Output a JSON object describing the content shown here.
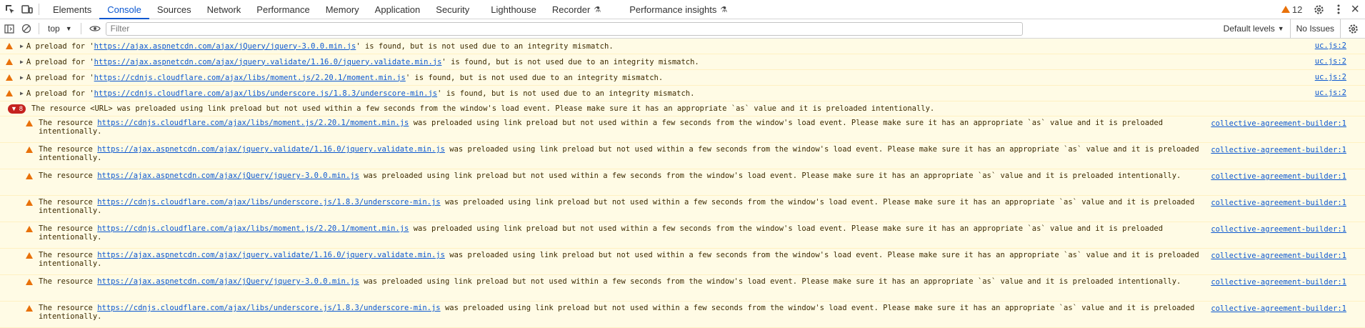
{
  "tabs": [
    {
      "label": "Elements",
      "flask": ""
    },
    {
      "label": "Console",
      "flask": ""
    },
    {
      "label": "Sources",
      "flask": ""
    },
    {
      "label": "Network",
      "flask": ""
    },
    {
      "label": "Performance",
      "flask": ""
    },
    {
      "label": "Memory",
      "flask": ""
    },
    {
      "label": "Application",
      "flask": ""
    },
    {
      "label": "Security",
      "flask": ""
    },
    {
      "label": "Lighthouse",
      "flask": ""
    },
    {
      "label": "Recorder",
      "flask": "⚗"
    },
    {
      "label": "Performance insights",
      "flask": "⚗"
    }
  ],
  "issues_count": "12",
  "toolbar": {
    "context": "top",
    "filter_placeholder": "Filter",
    "levels": "Default levels",
    "no_issues": "No Issues"
  },
  "warnings": [
    {
      "pre": "A preload for '",
      "url": "https://ajax.aspnetcdn.com/ajax/jQuery/jquery-3.0.0.min.js",
      "post": "' is found, but is not used due to an integrity mismatch.",
      "src": "uc.js:2"
    },
    {
      "pre": "A preload for '",
      "url": "https://ajax.aspnetcdn.com/ajax/jquery.validate/1.16.0/jquery.validate.min.js",
      "post": "' is found, but is not used due to an integrity mismatch.",
      "src": "uc.js:2"
    },
    {
      "pre": "A preload for '",
      "url": "https://cdnjs.cloudflare.com/ajax/libs/moment.js/2.20.1/moment.min.js",
      "post": "' is found, but is not used due to an integrity mismatch.",
      "src": "uc.js:2"
    },
    {
      "pre": "A preload for '",
      "url": "https://cdnjs.cloudflare.com/ajax/libs/underscore.js/1.8.3/underscore-min.js",
      "post": "' is found, but is not used due to an integrity mismatch.",
      "src": "uc.js:2"
    }
  ],
  "group": {
    "count": "8",
    "text": "The resource <URL> was preloaded using link preload but not used within a few seconds from the window's load event. Please make sure it has an appropriate `as` value and it is preloaded intentionally."
  },
  "children": [
    {
      "url": "https://cdnjs.cloudflare.com/ajax/libs/moment.js/2.20.1/moment.min.js",
      "src": "collective-agreement-builder:1"
    },
    {
      "url": "https://ajax.aspnetcdn.com/ajax/jquery.validate/1.16.0/jquery.validate.min.js",
      "src": "collective-agreement-builder:1"
    },
    {
      "url": "https://ajax.aspnetcdn.com/ajax/jQuery/jquery-3.0.0.min.js",
      "src": "collective-agreement-builder:1"
    },
    {
      "url": "https://cdnjs.cloudflare.com/ajax/libs/underscore.js/1.8.3/underscore-min.js",
      "src": "collective-agreement-builder:1"
    },
    {
      "url": "https://cdnjs.cloudflare.com/ajax/libs/moment.js/2.20.1/moment.min.js",
      "src": "collective-agreement-builder:1"
    },
    {
      "url": "https://ajax.aspnetcdn.com/ajax/jquery.validate/1.16.0/jquery.validate.min.js",
      "src": "collective-agreement-builder:1"
    },
    {
      "url": "https://ajax.aspnetcdn.com/ajax/jQuery/jquery-3.0.0.min.js",
      "src": "collective-agreement-builder:1"
    },
    {
      "url": "https://cdnjs.cloudflare.com/ajax/libs/underscore.js/1.8.3/underscore-min.js",
      "src": "collective-agreement-builder:1"
    }
  ],
  "child_pre": "The resource ",
  "child_post": " was preloaded using link preload but not used within a few seconds from the window's load event. Please make sure it has an appropriate `as` value and it is preloaded intentionally."
}
